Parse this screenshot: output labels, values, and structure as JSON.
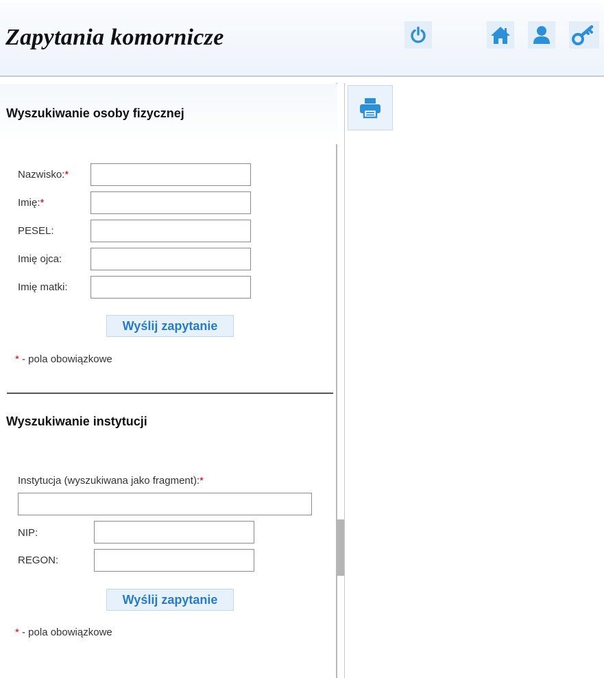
{
  "header": {
    "title": "Zapytania komornicze",
    "icons": {
      "power": "power-icon",
      "home": "home-icon",
      "user": "user-icon",
      "key": "key-icon"
    },
    "accent_color": "#2d8fd5"
  },
  "person_search": {
    "title": "Wyszukiwanie osoby fizycznej",
    "fields": {
      "surname": {
        "label": "Nazwisko:",
        "required_mark": "*",
        "value": ""
      },
      "first_name": {
        "label": "Imię:",
        "required_mark": "*",
        "value": ""
      },
      "pesel": {
        "label": "PESEL:",
        "value": ""
      },
      "father_name": {
        "label": "Imię ojca:",
        "value": ""
      },
      "mother_name": {
        "label": "Imię matki:",
        "value": ""
      }
    },
    "submit_label": "Wyślij zapytanie",
    "required_note_mark": "*",
    "required_note": " - pola obowiązkowe"
  },
  "institution_search": {
    "title": "Wyszukiwanie instytucji",
    "fields": {
      "institution": {
        "label": "Instytucja (wyszukiwana jako fragment):",
        "required_mark": "*",
        "value": ""
      },
      "nip": {
        "label": "NIP:",
        "value": ""
      },
      "regon": {
        "label": "REGON:",
        "value": ""
      }
    },
    "submit_label": "Wyślij zapytanie",
    "required_note_mark": "*",
    "required_note": " - pola obowiązkowe"
  },
  "toolbar": {
    "print_icon": "printer-icon"
  }
}
